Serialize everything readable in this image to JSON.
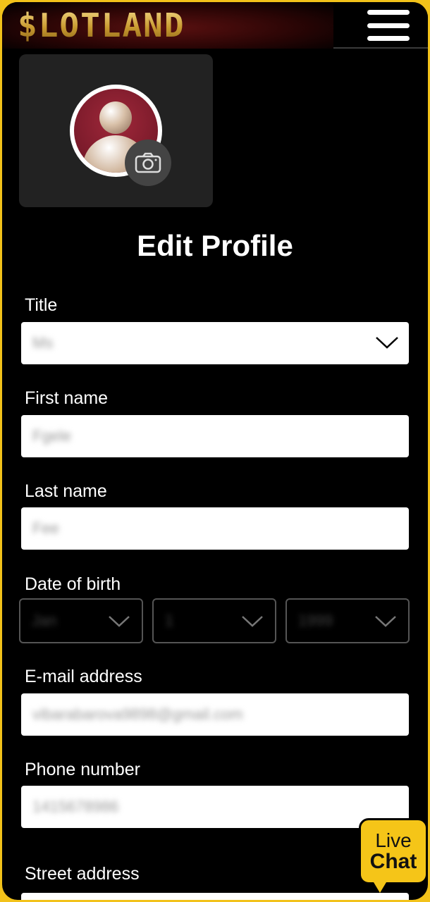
{
  "header": {
    "logo_text": "$LOTLAND",
    "menu_icon": "hamburger-menu-icon"
  },
  "avatar": {
    "camera_icon": "camera-icon"
  },
  "page": {
    "title": "Edit Profile"
  },
  "form": {
    "title_label": "Title",
    "title_value": "Ms",
    "first_name_label": "First name",
    "first_name_value": "Fgele",
    "last_name_label": "Last name",
    "last_name_value": "Fee",
    "dob_label": "Date of birth",
    "dob_month": "Jan",
    "dob_day": "1",
    "dob_year": "1999",
    "email_label": "E-mail address",
    "email_value": "vibarabarova9898@gmail.com",
    "phone_label": "Phone number",
    "phone_value": "1415678986",
    "street_label": "Street address"
  },
  "live_chat": {
    "line1": "Live",
    "line2": "Chat"
  },
  "colors": {
    "background": "#000000",
    "frame": "#f2c21a",
    "chat_button": "#f5c518",
    "logo_gold": "#d6a83a"
  }
}
